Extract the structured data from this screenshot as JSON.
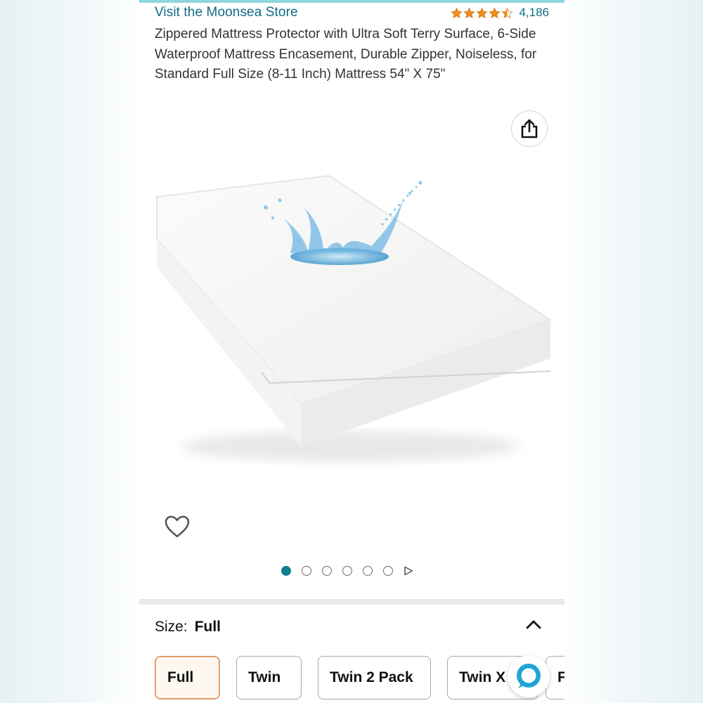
{
  "header": {
    "store_link": "Visit the Moonsea Store",
    "rating_value": 4.5,
    "rating_max": 5,
    "rating_count": "4,186"
  },
  "product": {
    "title": "Zippered Mattress Protector with Ultra Soft Terry Surface, 6-Side Waterproof Mattress Encasement, Durable Zipper, Noiseless, for Standard Full Size (8-11 Inch) Mattress 54\" X 75\""
  },
  "gallery": {
    "image_count": 6,
    "active_index": 0
  },
  "size_selector": {
    "label": "Size:",
    "selected": "Full",
    "options": [
      "Full",
      "Twin",
      "Twin 2 Pack",
      "Twin X",
      "F"
    ]
  },
  "icons": {
    "share": "share-icon",
    "favorite": "heart-icon",
    "collapse": "chevron-up-icon",
    "assistant": "assistant-chat-icon",
    "next": "play-triangle-icon"
  },
  "colors": {
    "link": "#0f6b86",
    "star": "#f08c1a",
    "dot_active": "#137f8e",
    "selected_border": "#e0a070",
    "accent_strip": "#8fd6dc"
  }
}
